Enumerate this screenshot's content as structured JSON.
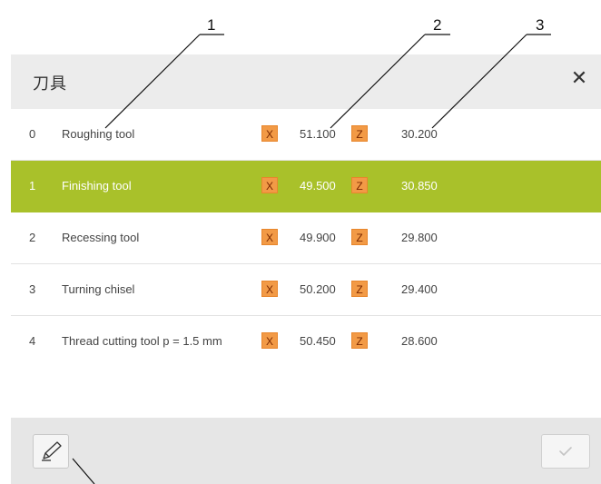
{
  "dialog": {
    "title": "刀具",
    "close_icon": "close-icon"
  },
  "callouts": [
    "1",
    "2",
    "3"
  ],
  "tools": [
    {
      "index": "0",
      "name": "Roughing tool",
      "x_label": "X",
      "x_value": "51.100",
      "z_label": "Z",
      "z_value": "30.200",
      "selected": false
    },
    {
      "index": "1",
      "name": "Finishing tool",
      "x_label": "X",
      "x_value": "49.500",
      "z_label": "Z",
      "z_value": "30.850",
      "selected": true
    },
    {
      "index": "2",
      "name": "Recessing tool",
      "x_label": "X",
      "x_value": "49.900",
      "z_label": "Z",
      "z_value": "29.800",
      "selected": false
    },
    {
      "index": "3",
      "name": "Turning chisel",
      "x_label": "X",
      "x_value": "50.200",
      "z_label": "Z",
      "z_value": "29.400",
      "selected": false
    },
    {
      "index": "4",
      "name": "Thread cutting tool p = 1.5 mm",
      "x_label": "X",
      "x_value": "50.450",
      "z_label": "Z",
      "z_value": "28.600",
      "selected": false
    }
  ],
  "footer": {
    "edit_icon": "pencil-icon",
    "confirm_icon": "checkmark-icon"
  },
  "colors": {
    "selected_row": "#a9c12a",
    "axis_badge": "#f29a46"
  }
}
